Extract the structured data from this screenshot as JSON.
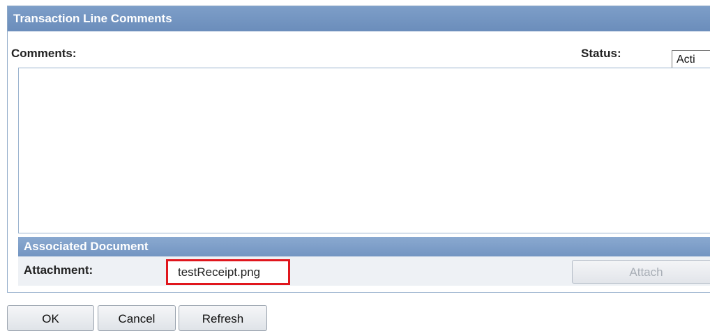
{
  "dialog": {
    "title": "Transaction Line Comments"
  },
  "comments": {
    "label": "Comments:",
    "value": ""
  },
  "status": {
    "label": "Status:",
    "selected": "Acti"
  },
  "associated_document": {
    "header": "Associated Document",
    "attachment_label": "Attachment:",
    "attachment_file": "testReceipt.png",
    "attach_button": "Attach"
  },
  "buttons": {
    "ok": "OK",
    "cancel": "Cancel",
    "refresh": "Refresh"
  },
  "colors": {
    "header_bg": "#7d9ec8",
    "highlight_border": "#e0161d"
  }
}
